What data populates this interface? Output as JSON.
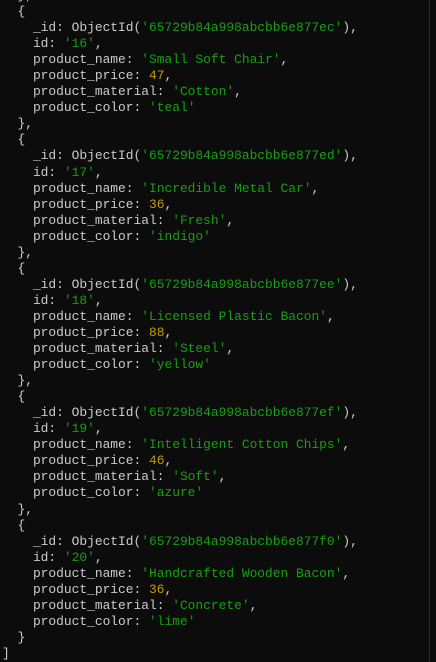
{
  "terminal": {
    "colors": {
      "background": "#0c0c0c",
      "text": "#cccccc",
      "string": "#13a10e",
      "number": "#c19c00"
    },
    "leading_line": "},",
    "records": [
      {
        "_id": "65729b84a998abcbb6e877ec",
        "id": "16",
        "product_name": "Small Soft Chair",
        "product_price": 47,
        "product_material": "Cotton",
        "product_color": "teal"
      },
      {
        "_id": "65729b84a998abcbb6e877ed",
        "id": "17",
        "product_name": "Incredible Metal Car",
        "product_price": 36,
        "product_material": "Fresh",
        "product_color": "indigo"
      },
      {
        "_id": "65729b84a998abcbb6e877ee",
        "id": "18",
        "product_name": "Licensed Plastic Bacon",
        "product_price": 88,
        "product_material": "Steel",
        "product_color": "yellow"
      },
      {
        "_id": "65729b84a998abcbb6e877ef",
        "id": "19",
        "product_name": "Intelligent Cotton Chips",
        "product_price": 46,
        "product_material": "Soft",
        "product_color": "azure"
      },
      {
        "_id": "65729b84a998abcbb6e877f0",
        "id": "20",
        "product_name": "Handcrafted Wooden Bacon",
        "product_price": 36,
        "product_material": "Concrete",
        "product_color": "lime"
      }
    ],
    "closing_line": "]"
  }
}
